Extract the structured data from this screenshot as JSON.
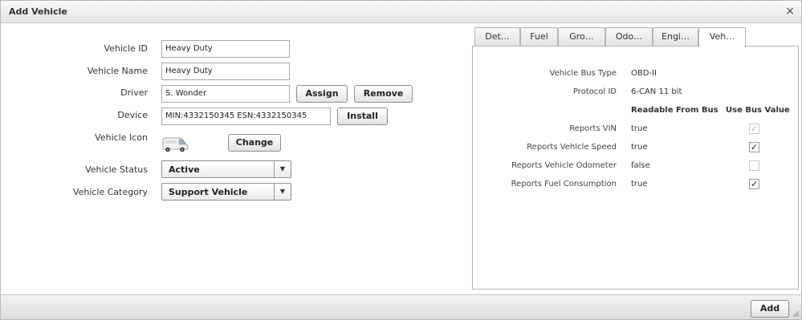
{
  "dialog": {
    "title": "Add Vehicle",
    "close_icon": "×"
  },
  "form": {
    "vehicle_id": {
      "label": "Vehicle ID",
      "value": "Heavy Duty"
    },
    "vehicle_name": {
      "label": "Vehicle Name",
      "value": "Heavy Duty"
    },
    "driver": {
      "label": "Driver",
      "value": "S. Wonder",
      "assign_label": "Assign",
      "remove_label": "Remove"
    },
    "device": {
      "label": "Device",
      "value": "MIN:4332150345 ESN:4332150345",
      "install_label": "Install"
    },
    "vehicle_icon": {
      "label": "Vehicle Icon",
      "icon": "van-icon",
      "change_label": "Change"
    },
    "vehicle_status": {
      "label": "Vehicle Status",
      "value": "Active"
    },
    "vehicle_category": {
      "label": "Vehicle Category",
      "value": "Support Vehicle"
    },
    "dropdown_arrow": "▼"
  },
  "tabs": [
    {
      "label": "Det…",
      "active": false
    },
    {
      "label": "Fuel",
      "active": false
    },
    {
      "label": "Gro…",
      "active": false
    },
    {
      "label": "Odo…",
      "active": false
    },
    {
      "label": "Engi…",
      "active": false
    },
    {
      "label": "Veh…",
      "active": true
    }
  ],
  "vehicle_bus": {
    "bus_type_label": "Vehicle Bus Type",
    "bus_type_value": "OBD-II",
    "protocol_label": "Protocol ID",
    "protocol_value": "6-CAN 11 bit",
    "col_readable": "Readable From Bus",
    "col_use_bus": "Use Bus Value",
    "rows": [
      {
        "label": "Reports VIN",
        "readable": "true",
        "use_bus": true,
        "disabled": true
      },
      {
        "label": "Reports Vehicle Speed",
        "readable": "true",
        "use_bus": true,
        "disabled": false
      },
      {
        "label": "Reports Vehicle Odometer",
        "readable": "false",
        "use_bus": false,
        "disabled": true
      },
      {
        "label": "Reports Fuel Consumption",
        "readable": "true",
        "use_bus": true,
        "disabled": false
      }
    ]
  },
  "footer": {
    "add_label": "Add"
  }
}
